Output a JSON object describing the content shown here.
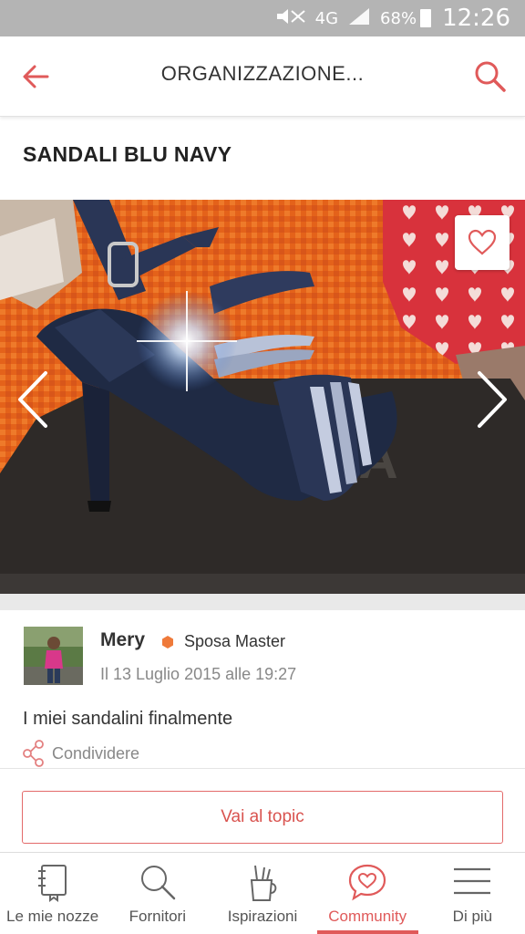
{
  "status_bar": {
    "network": "4G",
    "battery": "68%",
    "time": "12:26"
  },
  "app_bar": {
    "title": "ORGANIZZAZIONE..."
  },
  "post": {
    "title": "SANDALI BLU NAVY",
    "author": "Mery",
    "rank": "Sposa Master",
    "date": "Il 13 Luglio 2015 alle 19:27",
    "body": "I miei sandalini finalmente",
    "share_label": "Condividere"
  },
  "actions": {
    "topic_button": "Vai al topic"
  },
  "bottom_nav": {
    "items": [
      {
        "label": "Le mie nozze",
        "icon": "notebook-icon"
      },
      {
        "label": "Fornitori",
        "icon": "search-icon"
      },
      {
        "label": "Ispirazioni",
        "icon": "pencil-cup-icon"
      },
      {
        "label": "Community",
        "icon": "heart-chat-icon",
        "active": true
      },
      {
        "label": "Di più",
        "icon": "menu-icon"
      }
    ]
  },
  "colors": {
    "accent": "#e05a5a",
    "status_bar": "#b4b4b4"
  }
}
